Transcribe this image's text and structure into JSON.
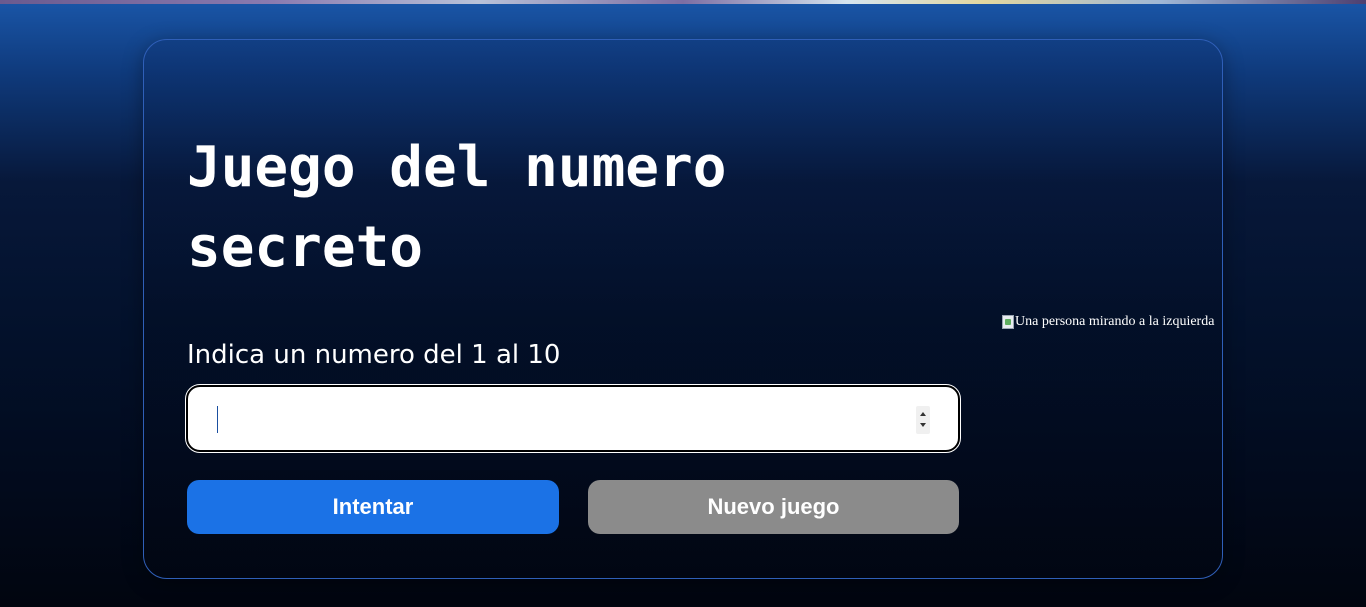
{
  "title": "Juego del numero secreto",
  "prompt": "Indica un numero del 1 al 10",
  "input": {
    "value": "",
    "placeholder": ""
  },
  "buttons": {
    "try_label": "Intentar",
    "new_game_label": "Nuevo juego"
  },
  "image": {
    "alt": "Una persona mirando a la izquierda",
    "icon": "broken-image-icon"
  },
  "colors": {
    "try_button": "#1b72e6",
    "new_game_button": "#8b8b8b",
    "card_border": "#2f5fb8",
    "background_top": "#1a56a8",
    "background_bottom": "#01050f"
  }
}
